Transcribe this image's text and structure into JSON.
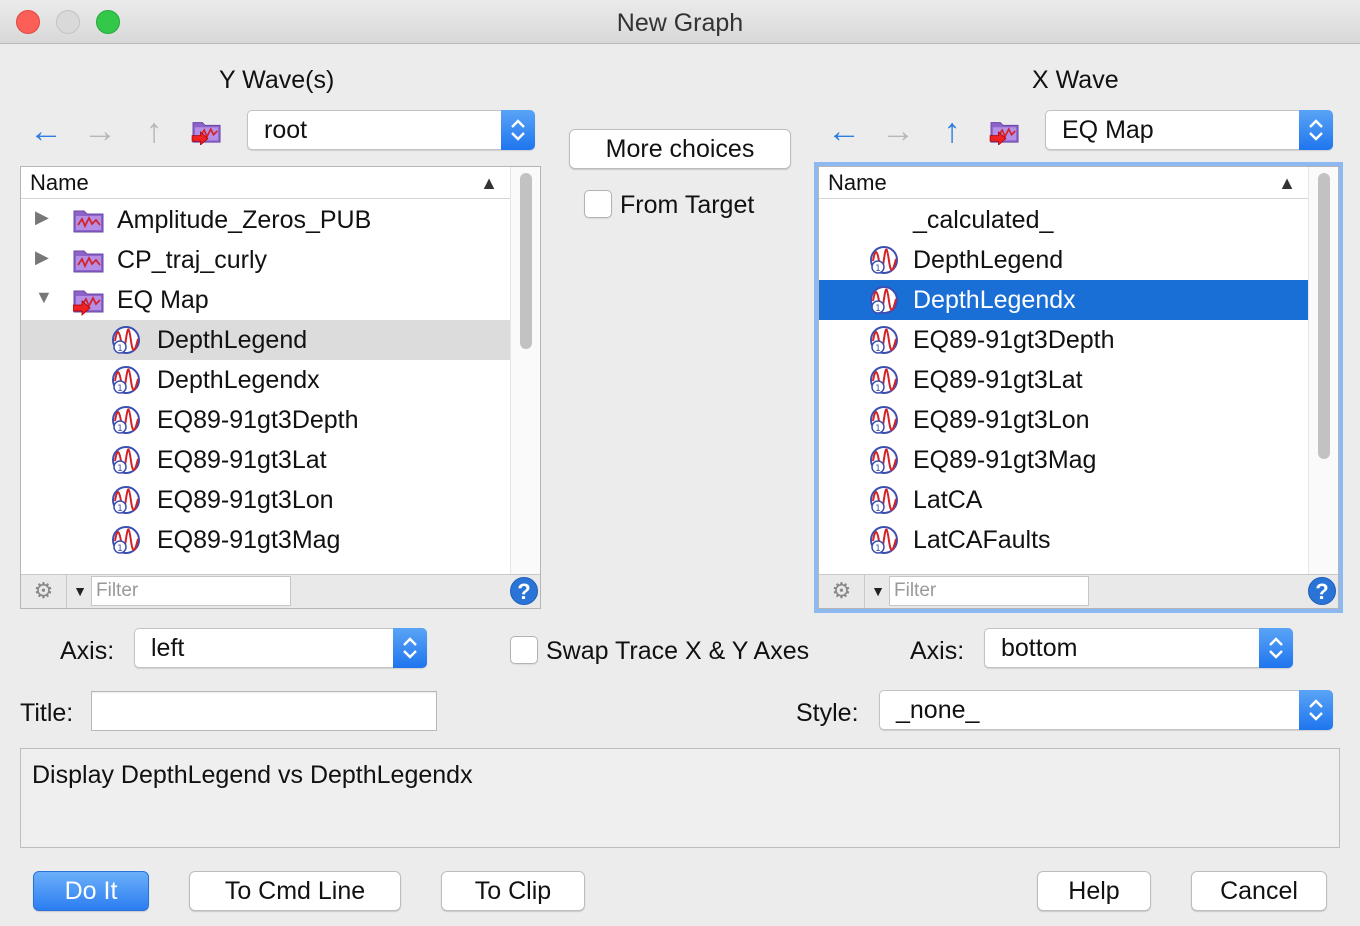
{
  "window": {
    "title": "New Graph"
  },
  "y_panel": {
    "heading": "Y Wave(s)",
    "folder_popup": "root",
    "column": "Name",
    "filter_placeholder": "Filter",
    "rows": [
      {
        "label": "Amplitude_Zeros_PUB",
        "kind": "folder",
        "level": 0,
        "disclosure": "▶"
      },
      {
        "label": "CP_traj_curly",
        "kind": "folder",
        "level": 0,
        "disclosure": "▶"
      },
      {
        "label": "EQ Map",
        "kind": "folder-current",
        "level": 0,
        "disclosure": "▼"
      },
      {
        "label": "DepthLegend",
        "kind": "wave",
        "level": 1,
        "state": "hover"
      },
      {
        "label": "DepthLegendx",
        "kind": "wave",
        "level": 1
      },
      {
        "label": "EQ89-91gt3Depth",
        "kind": "wave",
        "level": 1
      },
      {
        "label": "EQ89-91gt3Lat",
        "kind": "wave",
        "level": 1
      },
      {
        "label": "EQ89-91gt3Lon",
        "kind": "wave",
        "level": 1
      },
      {
        "label": "EQ89-91gt3Mag",
        "kind": "wave",
        "level": 1
      }
    ],
    "axis_label": "Axis:",
    "axis_value": "left"
  },
  "middle": {
    "more_choices": "More choices",
    "from_target": "From Target",
    "swap_axes": "Swap Trace X & Y Axes"
  },
  "x_panel": {
    "heading": "X Wave",
    "folder_popup": "EQ Map",
    "column": "Name",
    "filter_placeholder": "Filter",
    "rows": [
      {
        "label": "_calculated_",
        "kind": "none"
      },
      {
        "label": "DepthLegend",
        "kind": "wave"
      },
      {
        "label": "DepthLegendx",
        "kind": "wave",
        "state": "selected"
      },
      {
        "label": "EQ89-91gt3Depth",
        "kind": "wave"
      },
      {
        "label": "EQ89-91gt3Lat",
        "kind": "wave"
      },
      {
        "label": "EQ89-91gt3Lon",
        "kind": "wave"
      },
      {
        "label": "EQ89-91gt3Mag",
        "kind": "wave"
      },
      {
        "label": "LatCA",
        "kind": "wave"
      },
      {
        "label": "LatCAFaults",
        "kind": "wave"
      }
    ],
    "axis_label": "Axis:",
    "axis_value": "bottom"
  },
  "title_field": {
    "label": "Title:",
    "value": ""
  },
  "style_field": {
    "label": "Style:",
    "value": "_none_"
  },
  "command": {
    "text": "Display DepthLegend vs DepthLegendx"
  },
  "buttons": {
    "do_it": "Do It",
    "to_cmd_line": "To Cmd Line",
    "to_clip": "To Clip",
    "help": "Help",
    "cancel": "Cancel"
  },
  "icons": {
    "back": "arrow-left-icon",
    "forward": "arrow-right-icon",
    "up": "arrow-up-icon",
    "folder": "data-folder-icon",
    "wave": "wave-icon",
    "gear": "gear-icon",
    "help": "help-icon"
  },
  "colors": {
    "accent": "#2f7fe3",
    "selection": "#1a6fd6",
    "wave_stroke": "#d2232a",
    "wave_ring": "#3b4fb0"
  }
}
